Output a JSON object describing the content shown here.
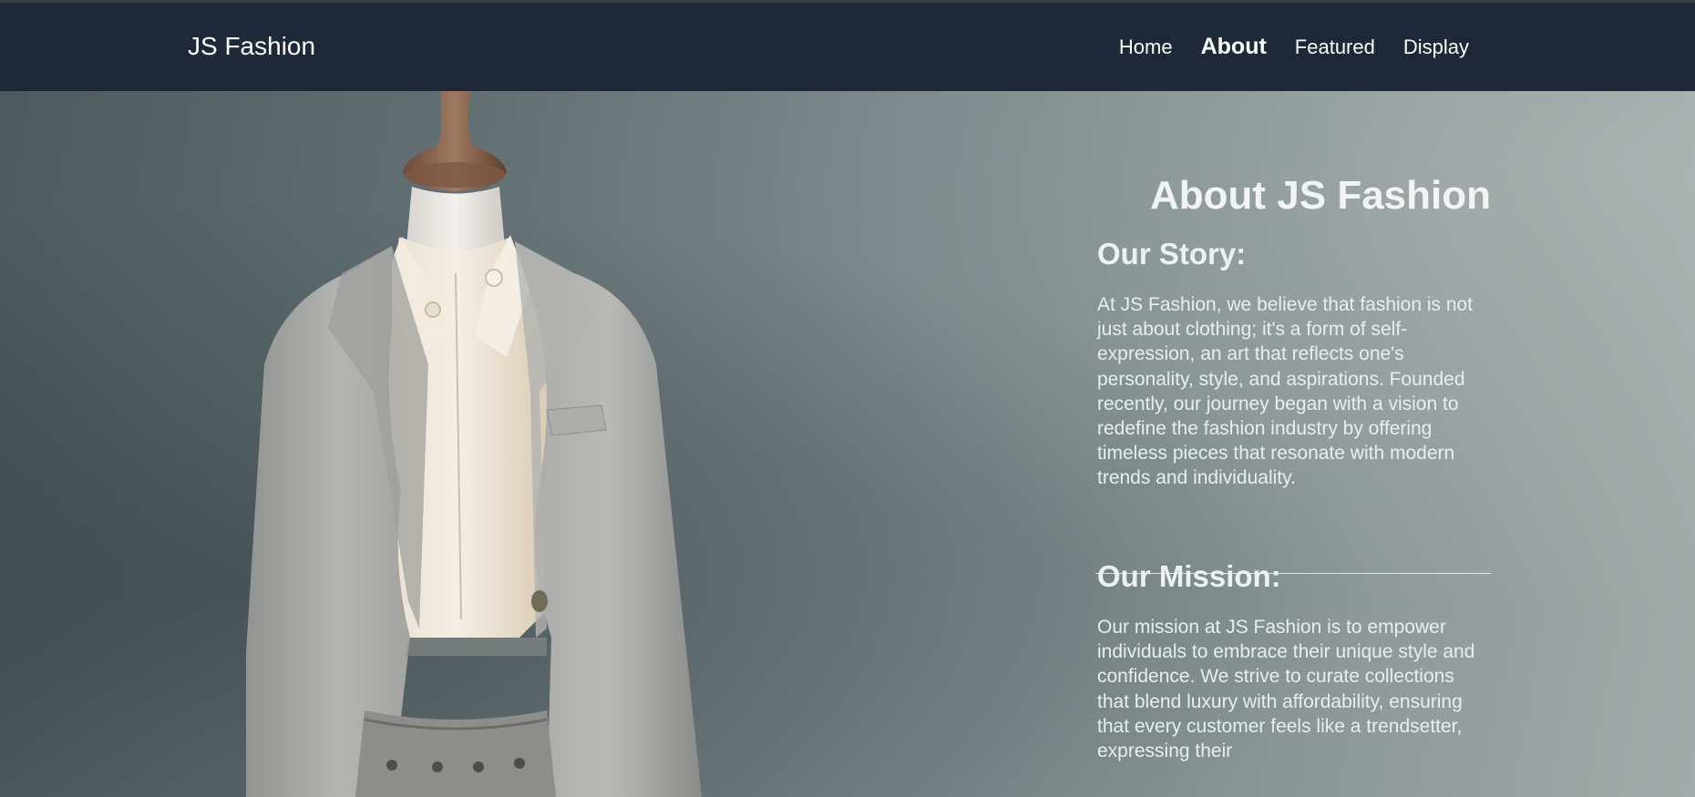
{
  "brand": "JS Fashion",
  "nav": {
    "items": [
      {
        "label": "Home",
        "active": false
      },
      {
        "label": "About",
        "active": true
      },
      {
        "label": "Featured",
        "active": false
      },
      {
        "label": "Display",
        "active": false
      }
    ]
  },
  "about": {
    "title": "About JS Fashion",
    "story_heading": "Our Story:",
    "story_text": "At JS Fashion, we believe that fashion is not just about clothing; it's a form of self-expression, an art that reflects one's personality, style, and aspirations. Founded recently, our journey began with a vision to redefine the fashion industry by offering timeless pieces that resonate with modern trends and individuality.",
    "mission_heading": "Our Mission:",
    "mission_text": "Our mission at JS Fashion is to empower individuals to embrace their unique style and confidence. We strive to curate collections that blend luxury with affordability, ensuring that every customer feels like a trendsetter, expressing their"
  },
  "colors": {
    "navbar": "#1f2838",
    "text": "#ffffff"
  }
}
